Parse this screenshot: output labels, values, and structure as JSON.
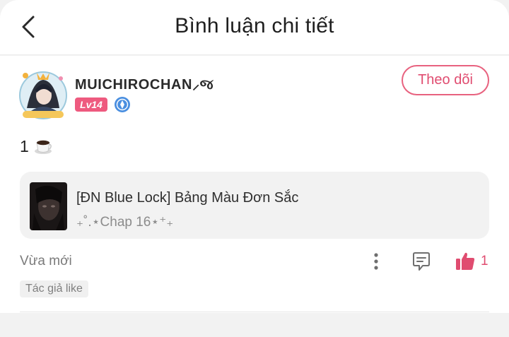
{
  "header": {
    "title": "Bình luận chi tiết",
    "back_icon": "chevron-left-icon"
  },
  "comment": {
    "username": "MUICHIROCHAN⸝જ",
    "level": "Lv14",
    "follow_label": "Theo dõi",
    "text": "1",
    "emoji_icon": "coffee-cup-icon",
    "story": {
      "title": "[ĐN Blue Lock] Bảng Màu Đơn Sắc",
      "chapter": "₊˚.⋆Chap 16⋆⁺₊"
    },
    "time": "Vừa mới",
    "like_count": "1",
    "author_like_tag": "Tác giả like"
  },
  "colors": {
    "accent": "#e04c70",
    "level_badge": "#ee5a7f",
    "rank_icon": "#4a8fe0"
  }
}
